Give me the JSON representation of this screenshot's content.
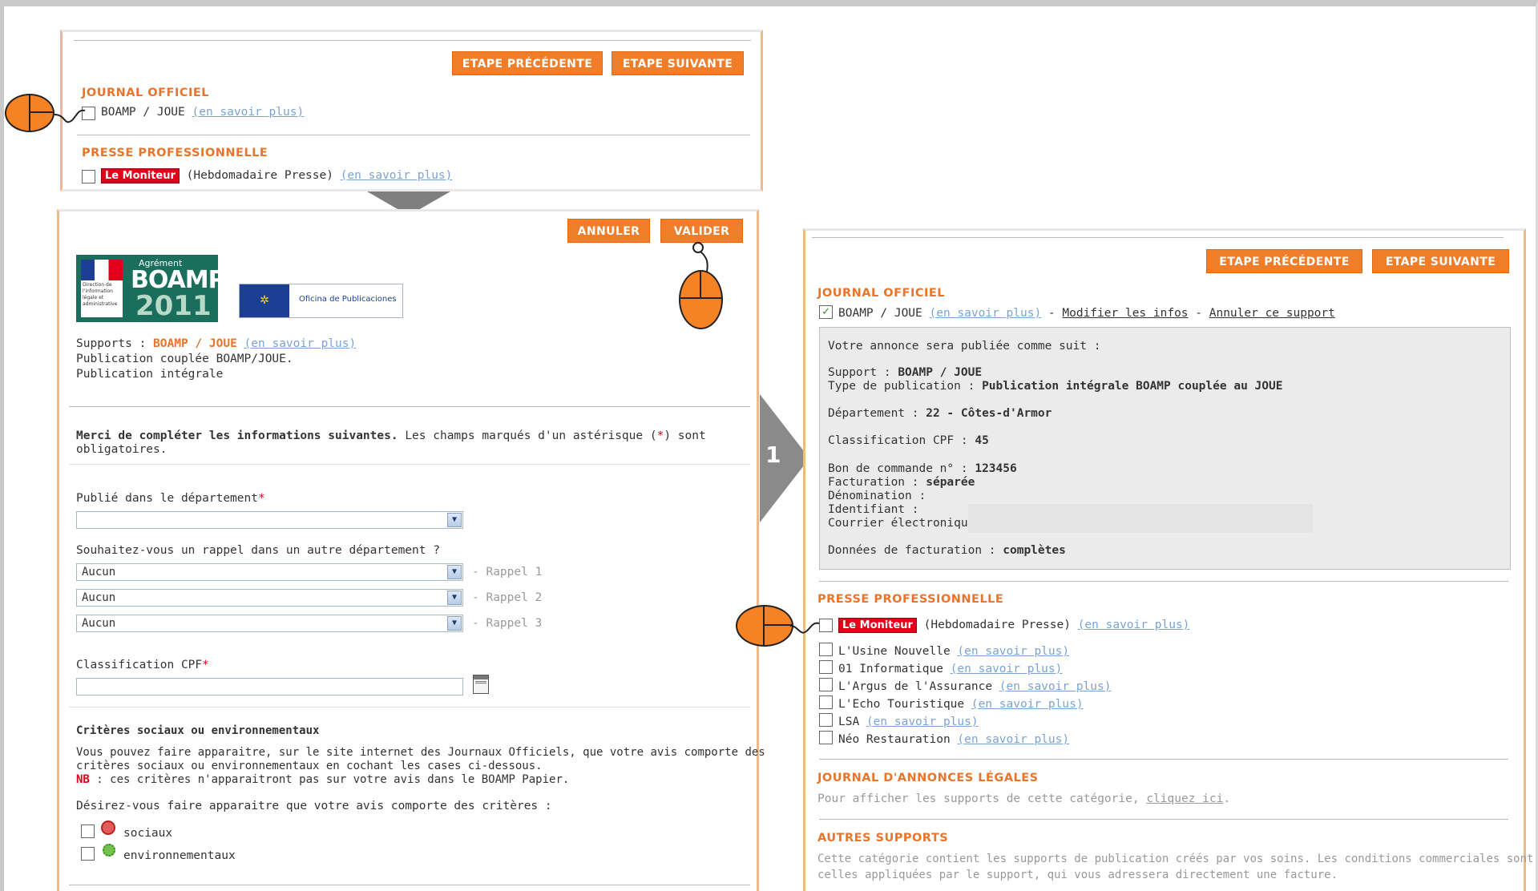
{
  "buttons": {
    "prev": "ETAPE PRÉCÉDENTE",
    "next": "ETAPE SUIVANTE",
    "cancel": "ANNULER",
    "validate": "VALIDER"
  },
  "top_panel": {
    "journal_officiel": "JOURNAL OFFICIEL",
    "boamp": "BOAMP / JOUE",
    "learn_more": "(en savoir plus)",
    "presse_pro": "PRESSE PROFESSIONNELLE",
    "moniteur": "Le Moniteur",
    "moniteur_desc": "(Hebdomadaire Presse)"
  },
  "form_panel": {
    "logo_agrement": "Agrément",
    "logo_boamp": "BOAMP",
    "logo_year": "2011",
    "logo_eu": "Oficina de Publicaciones",
    "supports_label": "Supports :",
    "supports_value": "BOAMP / JOUE",
    "learn_more": "(en savoir plus)",
    "pub_coupled": "Publication couplée BOAMP/JOUE.",
    "pub_full": "Publication intégrale",
    "intro_bold": "Merci de compléter les informations suivantes.",
    "intro_rest": "Les champs marqués d'un astérisque (",
    "intro_star": "*",
    "intro_end": ") sont",
    "intro_line2": "obligatoires.",
    "dept_label": "Publié dans le département",
    "star": "*",
    "dept_value": "",
    "recall_question": "Souhaitez-vous un rappel dans un autre département ?",
    "recalls": [
      {
        "value": "Aucun",
        "label": "- Rappel 1"
      },
      {
        "value": "Aucun",
        "label": "- Rappel 2"
      },
      {
        "value": "Aucun",
        "label": "- Rappel 3"
      }
    ],
    "cpf_label": "Classification CPF",
    "cpf_value": "",
    "criteria_title": "Critères sociaux ou environnementaux",
    "criteria_p1": "Vous pouvez faire apparaitre, sur le site internet des Journaux Officiels, que votre avis comporte des",
    "criteria_p2": "critères sociaux ou environnementaux en cochant les cases ci-dessous.",
    "nb_label": "NB",
    "nb_text": ": ces critères n'apparaitront pas sur votre avis dans le BOAMP Papier.",
    "criteria_question": "Désirez-vous faire apparaitre que votre avis comporte des critères :",
    "social": "sociaux",
    "env": "environnementaux"
  },
  "step_number": "1",
  "right_panel": {
    "journal_officiel": "JOURNAL OFFICIEL",
    "boamp": "BOAMP / JOUE",
    "learn_more": "(en savoir plus)",
    "sep": "-",
    "modify": "Modifier les infos",
    "cancel_support": "Annuler ce support",
    "summary_intro": "Votre annonce sera publiée comme suit :",
    "support_label": "Support :",
    "support_value": "BOAMP / JOUE",
    "type_label": "Type de publication :",
    "type_value": "Publication intégrale BOAMP couplée au JOUE",
    "dept_label": "Département :",
    "dept_value": "22 - Côtes-d'Armor",
    "cpf_label": "Classification CPF :",
    "cpf_value": "45",
    "order_label": "Bon de commande n° :",
    "order_value": "123456",
    "billing_label": "Facturation :",
    "billing_value": "séparée",
    "denom_label": "Dénomination :",
    "ident_label": "Identifiant :",
    "email_label": "Courrier électronique :",
    "billing_data_label": "Données de facturation :",
    "billing_data_value": "complètes",
    "presse_pro": "PRESSE PROFESSIONNELLE",
    "moniteur": "Le Moniteur",
    "moniteur_desc": "(Hebdomadaire Presse)",
    "press_list": [
      "L'Usine Nouvelle",
      "01 Informatique",
      "L'Argus de l'Assurance",
      "L'Echo Touristique",
      "LSA",
      "Néo Restauration"
    ],
    "jal_title": "JOURNAL D'ANNONCES LÉGALES",
    "jal_text": "Pour afficher les supports de cette catégorie,",
    "jal_link": "cliquez ici",
    "jal_dot": ".",
    "other_title": "AUTRES SUPPORTS",
    "other_p1": "Cette catégorie contient les supports de publication créés par vos soins. Les conditions commerciales sont",
    "other_p2": "celles appliquées par le support, qui vous adressera directement une facture."
  },
  "colors": {
    "accent": "#f07d2a",
    "section": "#e9742a",
    "link": "#7aa3d4",
    "moniteur": "#e2001a",
    "boamp_green": "#1b6e5b",
    "eu_blue": "#1d3f93"
  },
  "icons": [
    "mouse-icon",
    "checkbox-icon",
    "dropdown-arrow-icon",
    "calendar-icon",
    "social-icon",
    "environment-icon",
    "arrow-down-icon",
    "arrow-right-icon"
  ]
}
